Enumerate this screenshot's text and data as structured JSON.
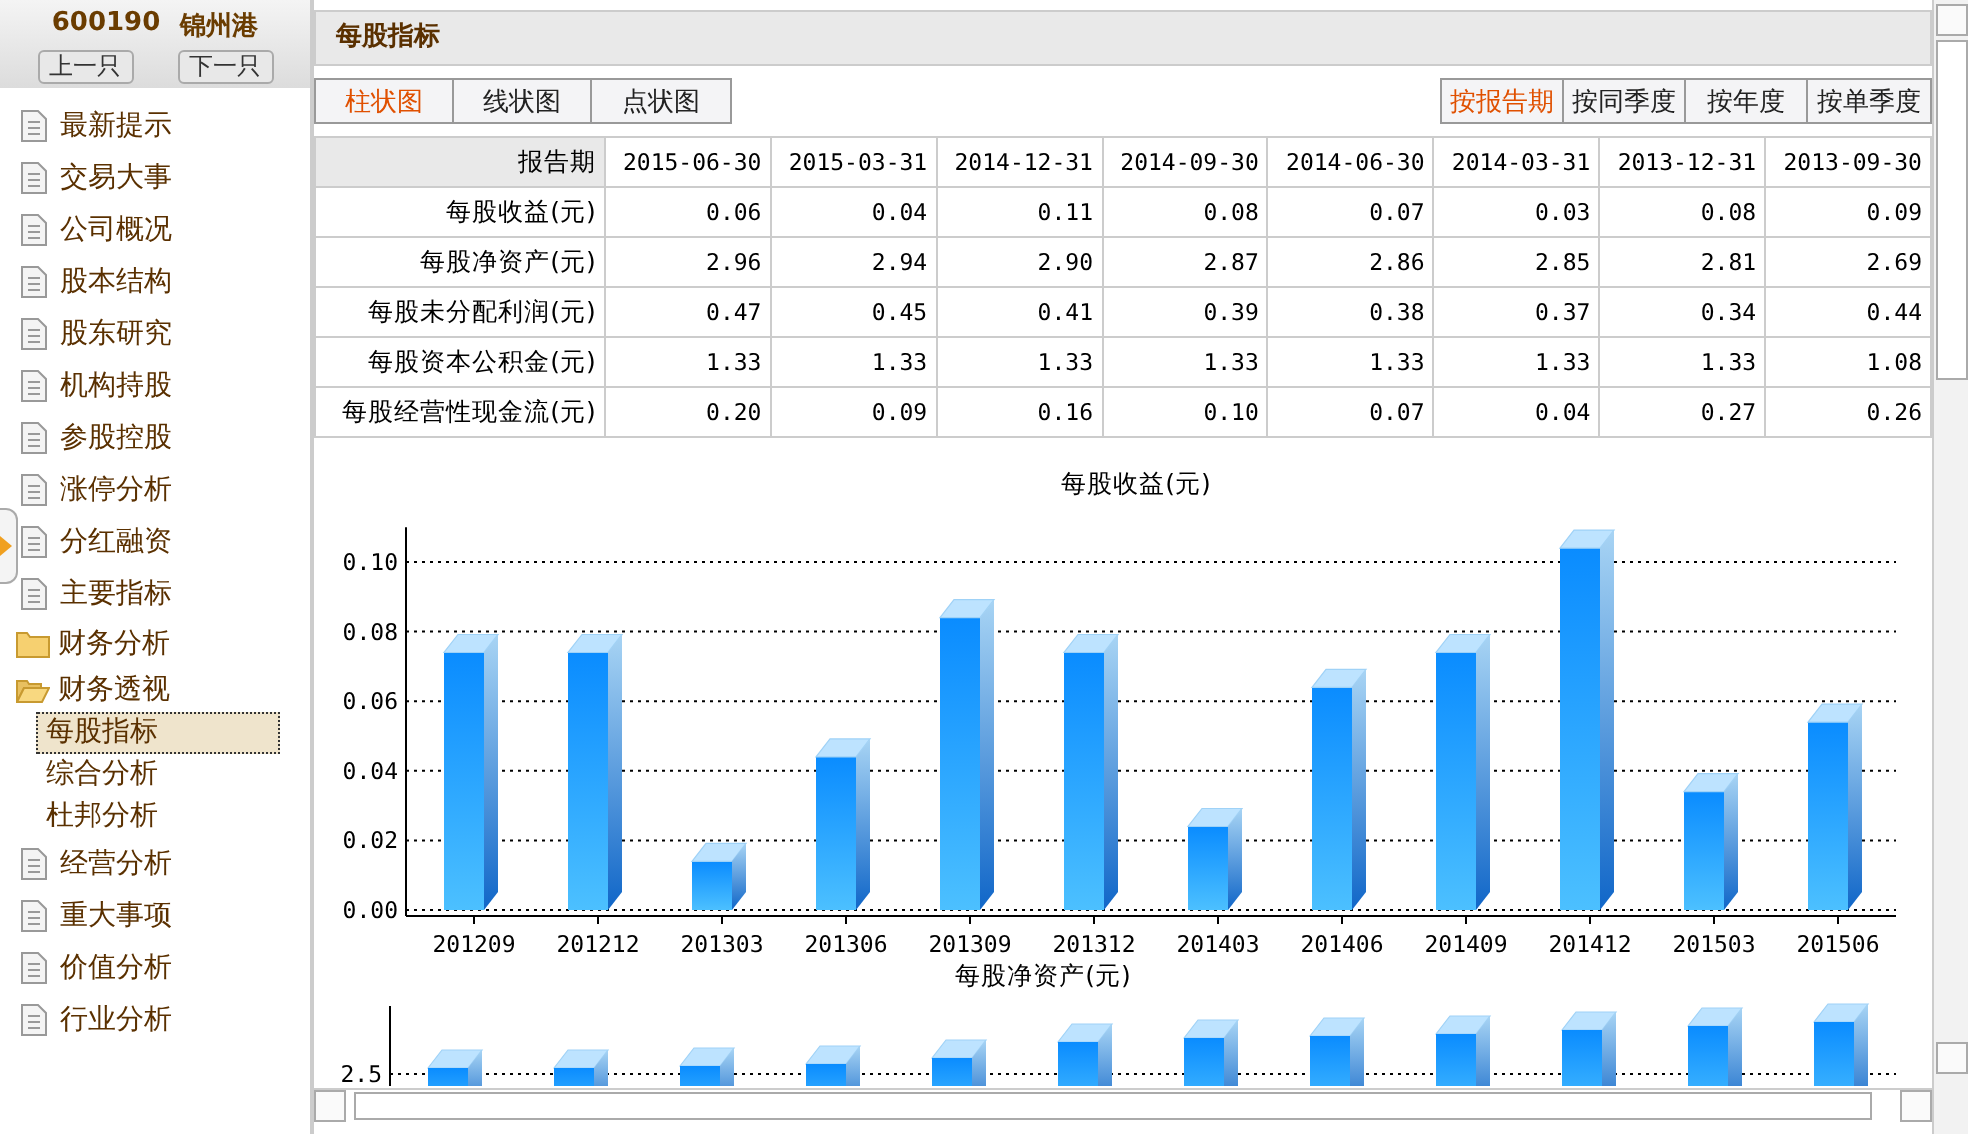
{
  "stock": {
    "code": "600190",
    "name": "锦州港"
  },
  "nav_buttons": [
    "上一只",
    "下一只"
  ],
  "sidebar": {
    "items": [
      {
        "kind": "page",
        "label": "最新提示"
      },
      {
        "kind": "page",
        "label": "交易大事"
      },
      {
        "kind": "page",
        "label": "公司概况"
      },
      {
        "kind": "page",
        "label": "股本结构"
      },
      {
        "kind": "page",
        "label": "股东研究"
      },
      {
        "kind": "page",
        "label": "机构持股"
      },
      {
        "kind": "page",
        "label": "参股控股"
      },
      {
        "kind": "page",
        "label": "涨停分析"
      },
      {
        "kind": "page",
        "label": "分红融资"
      },
      {
        "kind": "page",
        "label": "主要指标"
      },
      {
        "kind": "folder",
        "label": "财务分析",
        "expanded": false
      },
      {
        "kind": "folder",
        "label": "财务透视",
        "expanded": true,
        "children": [
          {
            "label": "每股指标",
            "selected": true
          },
          {
            "label": "综合分析",
            "selected": false
          },
          {
            "label": "杜邦分析",
            "selected": false
          }
        ]
      },
      {
        "kind": "page",
        "label": "经营分析"
      },
      {
        "kind": "page",
        "label": "重大事项"
      },
      {
        "kind": "page",
        "label": "价值分析"
      },
      {
        "kind": "page",
        "label": "行业分析"
      }
    ]
  },
  "panel": {
    "title": "每股指标"
  },
  "chart_tabs": [
    {
      "label": "柱状图",
      "selected": true
    },
    {
      "label": "线状图",
      "selected": false
    },
    {
      "label": "点状图",
      "selected": false
    }
  ],
  "period_tabs": [
    {
      "label": "按报告期",
      "selected": true
    },
    {
      "label": "按同季度",
      "selected": false
    },
    {
      "label": "按年度",
      "selected": false
    },
    {
      "label": "按单季度",
      "selected": false
    }
  ],
  "table": {
    "columns": [
      "报告期",
      "2015-06-30",
      "2015-03-31",
      "2014-12-31",
      "2014-09-30",
      "2014-06-30",
      "2014-03-31",
      "2013-12-31",
      "2013-09-30"
    ],
    "rows": [
      {
        "label": "每股收益(元)",
        "values": [
          "0.06",
          "0.04",
          "0.11",
          "0.08",
          "0.07",
          "0.03",
          "0.08",
          "0.09"
        ]
      },
      {
        "label": "每股净资产(元)",
        "values": [
          "2.96",
          "2.94",
          "2.90",
          "2.87",
          "2.86",
          "2.85",
          "2.81",
          "2.69"
        ]
      },
      {
        "label": "每股未分配利润(元)",
        "values": [
          "0.47",
          "0.45",
          "0.41",
          "0.39",
          "0.38",
          "0.37",
          "0.34",
          "0.44"
        ]
      },
      {
        "label": "每股资本公积金(元)",
        "values": [
          "1.33",
          "1.33",
          "1.33",
          "1.33",
          "1.33",
          "1.33",
          "1.33",
          "1.08"
        ]
      },
      {
        "label": "每股经营性现金流(元)",
        "values": [
          "0.20",
          "0.09",
          "0.16",
          "0.10",
          "0.07",
          "0.04",
          "0.27",
          "0.26"
        ]
      }
    ]
  },
  "chart": {
    "chart_data": {
      "type": "bar",
      "title": "每股收益(元)",
      "categories": [
        "201209",
        "201212",
        "201303",
        "201306",
        "201309",
        "201312",
        "201403",
        "201406",
        "201409",
        "201412",
        "201503",
        "201506"
      ],
      "values": [
        0.074,
        0.074,
        0.014,
        0.044,
        0.084,
        0.074,
        0.024,
        0.064,
        0.074,
        0.104,
        0.034,
        0.054
      ],
      "ylim": [
        0,
        0.11
      ],
      "grid": true,
      "yticks": [
        {
          "value": 0,
          "label": "0.00"
        },
        {
          "value": 0.02,
          "label": "0.02"
        },
        {
          "value": 0.04,
          "label": "0.04"
        },
        {
          "value": 0.06,
          "label": "0.06"
        },
        {
          "value": 0.08,
          "label": "0.08"
        },
        {
          "value": 0.1,
          "label": "0.10"
        }
      ]
    }
  },
  "second_chart": {
    "title": "每股净资产(元)",
    "tick_label": "2.5"
  }
}
